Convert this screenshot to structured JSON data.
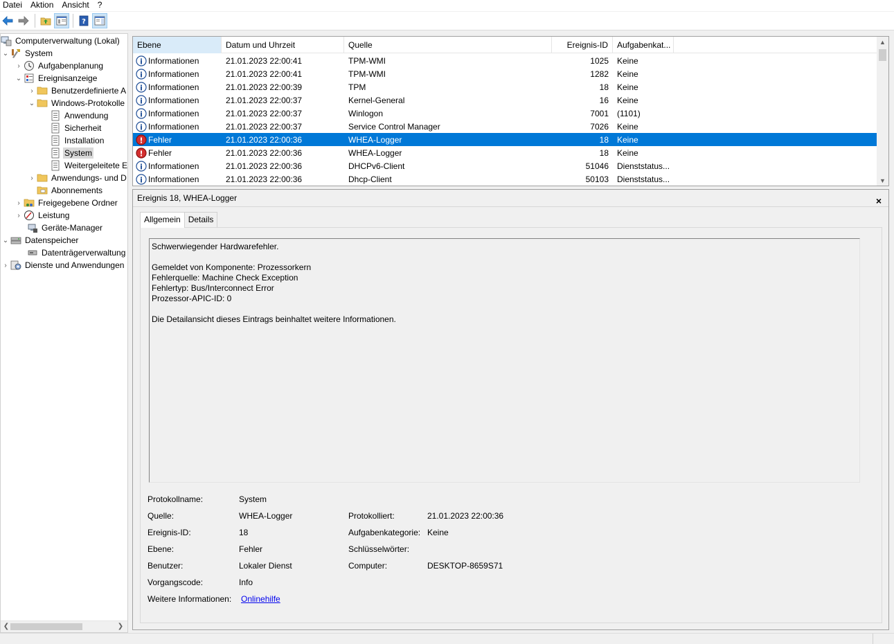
{
  "menu": {
    "items": [
      "Datei",
      "Aktion",
      "Ansicht",
      "?"
    ]
  },
  "toolbar": {
    "buttons": [
      "back-arrow-icon",
      "forward-arrow-icon",
      "up-folder-icon",
      "show-hide-tree-icon",
      "help-icon",
      "action-pane-icon"
    ]
  },
  "tree": {
    "items": [
      {
        "label": "Computerverwaltung (Lokal)",
        "icon": "computer-management-icon",
        "expander": ""
      },
      {
        "label": "System",
        "icon": "system-tools-icon",
        "expander": "v"
      },
      {
        "label": "Aufgabenplanung",
        "icon": "clock-icon",
        "expander": ">"
      },
      {
        "label": "Ereignisanzeige",
        "icon": "event-viewer-icon",
        "expander": "v"
      },
      {
        "label": "Benutzerdefinierte A",
        "icon": "folder-icon",
        "expander": ">"
      },
      {
        "label": "Windows-Protokolle",
        "icon": "folder-icon",
        "expander": "v"
      },
      {
        "label": "Anwendung",
        "icon": "log-icon",
        "expander": ""
      },
      {
        "label": "Sicherheit",
        "icon": "log-icon",
        "expander": ""
      },
      {
        "label": "Installation",
        "icon": "log-icon",
        "expander": ""
      },
      {
        "label": "System",
        "icon": "log-icon",
        "expander": ""
      },
      {
        "label": "Weitergeleitete E",
        "icon": "log-icon",
        "expander": ""
      },
      {
        "label": "Anwendungs- und D",
        "icon": "folder-icon",
        "expander": ">"
      },
      {
        "label": "Abonnements",
        "icon": "subscriptions-icon",
        "expander": ""
      },
      {
        "label": "Freigegebene Ordner",
        "icon": "shared-folders-icon",
        "expander": ">"
      },
      {
        "label": "Leistung",
        "icon": "performance-icon",
        "expander": ">"
      },
      {
        "label": "Geräte-Manager",
        "icon": "device-manager-icon",
        "expander": ""
      },
      {
        "label": "Datenspeicher",
        "icon": "storage-icon",
        "expander": "v"
      },
      {
        "label": "Datenträgerverwaltung",
        "icon": "disk-management-icon",
        "expander": ""
      },
      {
        "label": "Dienste und Anwendungen",
        "icon": "services-icon",
        "expander": ">"
      }
    ]
  },
  "event_list": {
    "columns": [
      "Ebene",
      "Datum und Uhrzeit",
      "Quelle",
      "Ereignis-ID",
      "Aufgabenkat..."
    ],
    "rows": [
      {
        "level": "Informationen",
        "type": "info",
        "datetime": "21.01.2023 22:00:41",
        "source": "TPM-WMI",
        "id": "1025",
        "category": "Keine"
      },
      {
        "level": "Informationen",
        "type": "info",
        "datetime": "21.01.2023 22:00:41",
        "source": "TPM-WMI",
        "id": "1282",
        "category": "Keine"
      },
      {
        "level": "Informationen",
        "type": "info",
        "datetime": "21.01.2023 22:00:39",
        "source": "TPM",
        "id": "18",
        "category": "Keine"
      },
      {
        "level": "Informationen",
        "type": "info",
        "datetime": "21.01.2023 22:00:37",
        "source": "Kernel-General",
        "id": "16",
        "category": "Keine"
      },
      {
        "level": "Informationen",
        "type": "info",
        "datetime": "21.01.2023 22:00:37",
        "source": "Winlogon",
        "id": "7001",
        "category": "(1101)"
      },
      {
        "level": "Informationen",
        "type": "info",
        "datetime": "21.01.2023 22:00:37",
        "source": "Service Control Manager",
        "id": "7026",
        "category": "Keine"
      },
      {
        "level": "Fehler",
        "type": "error",
        "datetime": "21.01.2023 22:00:36",
        "source": "WHEA-Logger",
        "id": "18",
        "category": "Keine"
      },
      {
        "level": "Fehler",
        "type": "error",
        "datetime": "21.01.2023 22:00:36",
        "source": "WHEA-Logger",
        "id": "18",
        "category": "Keine"
      },
      {
        "level": "Informationen",
        "type": "info",
        "datetime": "21.01.2023 22:00:36",
        "source": "DHCPv6-Client",
        "id": "51046",
        "category": "Dienststatus..."
      },
      {
        "level": "Informationen",
        "type": "info",
        "datetime": "21.01.2023 22:00:36",
        "source": "Dhcp-Client",
        "id": "50103",
        "category": "Dienststatus..."
      }
    ]
  },
  "detail": {
    "title": "Ereignis 18, WHEA-Logger",
    "close": "×",
    "tabs": [
      "Allgemein",
      "Details"
    ],
    "description": "Schwerwiegender Hardwarefehler.\n\nGemeldet von Komponente: Prozessorkern\nFehlerquelle: Machine Check Exception\nFehlertyp: Bus/Interconnect Error\nProzessor-APIC-ID: 0\n\nDie Detailansicht dieses Eintrags beinhaltet weitere Informationen.",
    "fields": {
      "protokollname_label": "Protokollname:",
      "protokollname": "System",
      "quelle_label": "Quelle:",
      "quelle": "WHEA-Logger",
      "protokolliert_label": "Protokolliert:",
      "protokolliert": "21.01.2023 22:00:36",
      "ereignisid_label": "Ereignis-ID:",
      "ereignisid": "18",
      "aufgabenkategorie_label": "Aufgabenkategorie:",
      "aufgabenkategorie": "Keine",
      "ebene_label": "Ebene:",
      "ebene": "Fehler",
      "schluesselwoerter_label": "Schlüsselwörter:",
      "schluesselwoerter": "",
      "benutzer_label": "Benutzer:",
      "benutzer": "Lokaler Dienst",
      "computer_label": "Computer:",
      "computer": "DESKTOP-8659S71",
      "vorgangscode_label": "Vorgangscode:",
      "vorgangscode": "Info",
      "weitere_label": "Weitere Informationen:",
      "weitere_link": "Onlinehilfe"
    }
  },
  "colors": {
    "selection": "#0078d7",
    "sorted_header": "#d9ebf9",
    "error": "#d32f2f",
    "info": "#1f4e96",
    "link": "#0000ee"
  }
}
